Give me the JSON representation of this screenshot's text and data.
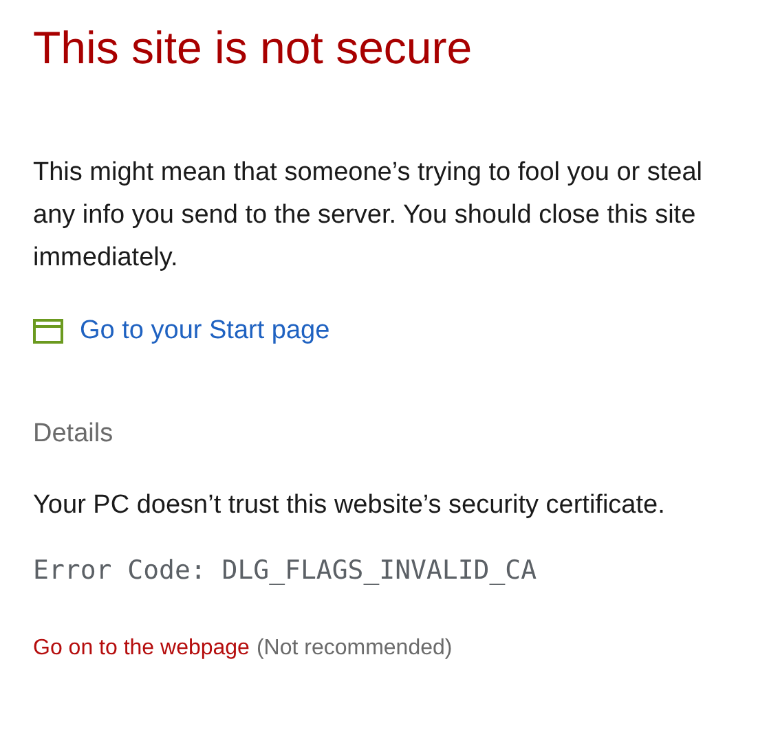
{
  "title": "This site is not secure",
  "message": "This might mean that someone’s trying to fool you or steal any info you send to the server. You should close this site immediately.",
  "start_link": "Go to your Start page",
  "details": {
    "heading": "Details",
    "text": "Your PC doesn’t trust this website’s security certificate.",
    "error_code": "Error Code: DLG_FLAGS_INVALID_CA"
  },
  "continue_link": "Go on to the webpage",
  "continue_note": "(Not recommended)"
}
